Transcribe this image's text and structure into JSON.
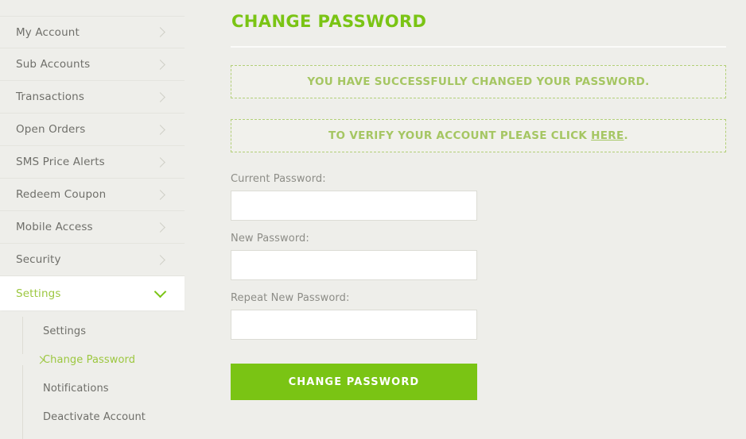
{
  "theme": {
    "background": "#eeeeea",
    "accent_green": "#7ac414",
    "muted_green": "#a5c662",
    "text_gray": "#6f6f6a",
    "label_gray": "#8d8d87",
    "input_background": "#ffffff",
    "active_row_background": "#ffffff"
  },
  "sidebar": {
    "items": [
      {
        "label": "My Account",
        "icon": "chevron-right-icon",
        "active": false
      },
      {
        "label": "Sub Accounts",
        "icon": "chevron-right-icon",
        "active": false
      },
      {
        "label": "Transactions",
        "icon": "chevron-right-icon",
        "active": false
      },
      {
        "label": "Open Orders",
        "icon": "chevron-right-icon",
        "active": false
      },
      {
        "label": "SMS Price Alerts",
        "icon": "chevron-right-icon",
        "active": false
      },
      {
        "label": "Redeem Coupon",
        "icon": "chevron-right-icon",
        "active": false
      },
      {
        "label": "Mobile Access",
        "icon": "chevron-right-icon",
        "active": false
      },
      {
        "label": "Security",
        "icon": "chevron-right-icon",
        "active": false
      },
      {
        "label": "Settings",
        "icon": "chevron-down-icon",
        "active": true
      }
    ],
    "submenu": [
      {
        "label": "Settings",
        "active": false
      },
      {
        "label": "Change Password",
        "active": true,
        "icon": "chevron-right-icon"
      },
      {
        "label": "Notifications",
        "active": false
      },
      {
        "label": "Deactivate Account",
        "active": false
      }
    ]
  },
  "main": {
    "title": "CHANGE PASSWORD",
    "alerts": [
      {
        "name": "success-alert",
        "text": "YOU HAVE SUCCESSFULLY CHANGED YOUR PASSWORD."
      },
      {
        "name": "verify-alert",
        "text_before": "TO VERIFY YOUR ACCOUNT PLEASE CLICK ",
        "link_text": "HERE",
        "text_after": "."
      }
    ],
    "form": {
      "current_password": {
        "label": "Current Password:",
        "value": "",
        "placeholder": ""
      },
      "new_password": {
        "label": "New Password:",
        "value": "",
        "placeholder": ""
      },
      "repeat_password": {
        "label": "Repeat New Password:",
        "value": "",
        "placeholder": ""
      },
      "submit_label": "CHANGE PASSWORD"
    }
  }
}
